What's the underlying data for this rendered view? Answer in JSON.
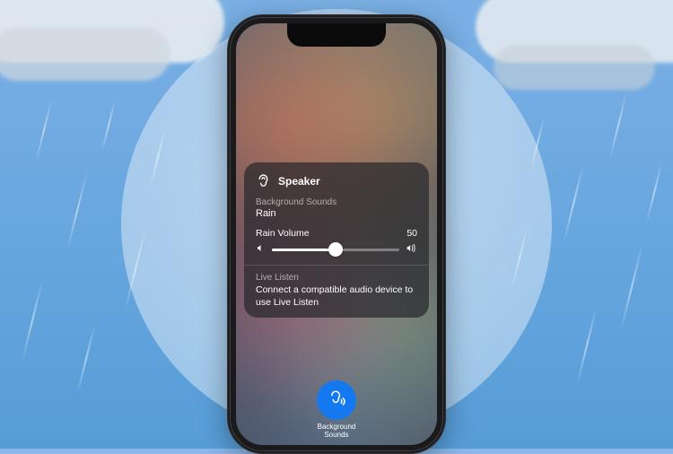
{
  "panel": {
    "header_title": "Speaker",
    "bg_sounds_label": "Background Sounds",
    "bg_sounds_value": "Rain",
    "volume_label": "Rain Volume",
    "volume_value": "50",
    "volume_percent": 50,
    "live_listen_label": "Live Listen",
    "live_listen_desc": "Connect a compatible audio device to use Live Listen"
  },
  "tile": {
    "label_line1": "Background",
    "label_line2": "Sounds"
  },
  "colors": {
    "accent": "#0a7aff"
  }
}
